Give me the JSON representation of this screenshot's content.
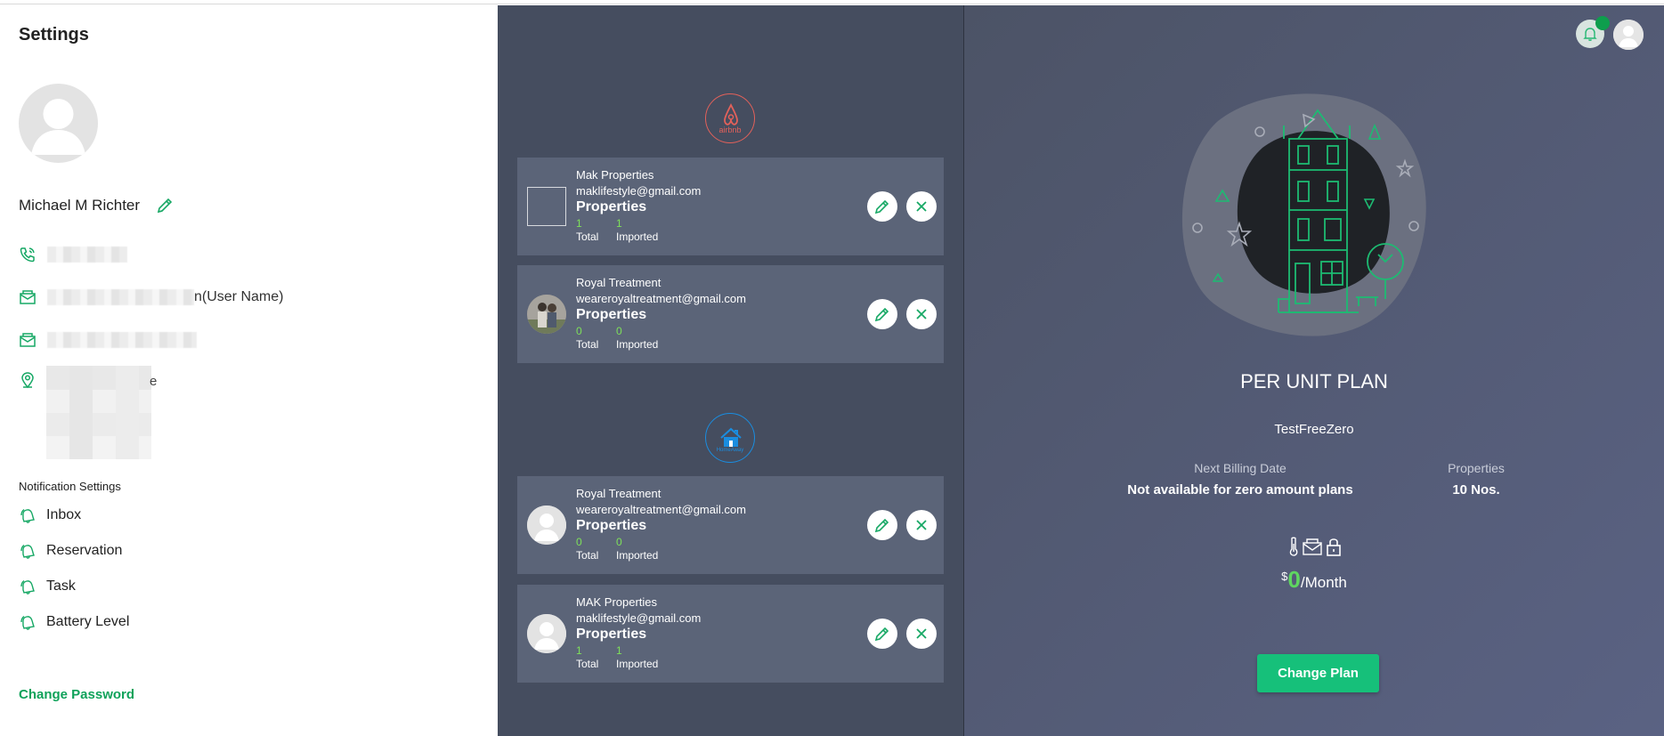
{
  "settings": {
    "title": "Settings",
    "user_name": "Michael M Richter",
    "email_suffix": "n(User Name)",
    "address_suffix": "e",
    "notification_title": "Notification Settings",
    "notifications": [
      "Inbox",
      "Reservation",
      "Task",
      "Battery Level"
    ],
    "change_password": "Change Password"
  },
  "channels": {
    "airbnb": {
      "logo_text": "airbnb",
      "accounts": [
        {
          "name": "Mak Properties",
          "email": "maklifestyle@gmail.com",
          "properties_label": "Properties",
          "total": "1",
          "imported": "1",
          "total_label": "Total",
          "imported_label": "Imported"
        },
        {
          "name": "Royal Treatment",
          "email": "weareroyaltreatment@gmail.com",
          "properties_label": "Properties",
          "total": "0",
          "imported": "0",
          "total_label": "Total",
          "imported_label": "Imported"
        }
      ]
    },
    "homeaway": {
      "logo_text": "HomeAway",
      "accounts": [
        {
          "name": "Royal Treatment",
          "email": "weareroyaltreatment@gmail.com",
          "properties_label": "Properties",
          "total": "0",
          "imported": "0",
          "total_label": "Total",
          "imported_label": "Imported"
        },
        {
          "name": "MAK Properties",
          "email": "maklifestyle@gmail.com",
          "properties_label": "Properties",
          "total": "1",
          "imported": "1",
          "total_label": "Total",
          "imported_label": "Imported"
        }
      ]
    }
  },
  "plan": {
    "name": "PER UNIT PLAN",
    "subtitle": "TestFreeZero",
    "billing_label": "Next Billing Date",
    "billing_value": "Not available for zero amount plans",
    "properties_label": "Properties",
    "properties_value": "10 Nos.",
    "currency": "$",
    "amount": "0",
    "period": "/Month",
    "change_plan": "Change Plan"
  },
  "colors": {
    "accent_green": "#16c07a",
    "link_green": "#0fa25a",
    "count_green": "#7ee05a",
    "airbnb_red": "#e3615a",
    "homeaway_blue": "#1a8de0",
    "middle_bg": "#454d5f",
    "card_bg": "#5b6478"
  },
  "icons": [
    "phone-icon",
    "envelope-icon",
    "map-pin-icon",
    "bell-icon",
    "pencil-icon",
    "close-icon",
    "thermometer-icon",
    "mail-icon",
    "lock-icon"
  ]
}
